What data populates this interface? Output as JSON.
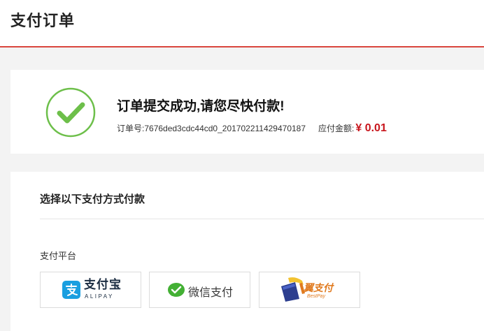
{
  "header": {
    "title": "支付订单"
  },
  "success": {
    "title": "订单提交成功,请您尽快付款!",
    "order_number_label": "订单号:",
    "order_number": "7676ded3cdc44cd0_201702211429470187",
    "amount_label": "应付金额:",
    "amount": "¥ 0.01",
    "icon": "checkmark-circle-icon",
    "colors": {
      "check": "#6dbf4a",
      "amount": "#c8161d",
      "accent_line": "#d9463e"
    }
  },
  "payment": {
    "heading": "选择以下支付方式付款",
    "platform_label": "支付平台",
    "options": [
      {
        "id": "alipay",
        "label": "支付宝",
        "sub_label": "ALIPAY",
        "icon": "alipay-logo-icon",
        "color": "#1a9fe0"
      },
      {
        "id": "wechat",
        "label": "微信支付",
        "icon": "wechat-pay-icon",
        "color": "#43b034"
      },
      {
        "id": "bestpay",
        "label": "翼支付",
        "sub_label": "BestPay",
        "icon": "bestpay-logo-icon",
        "color": "#e07a1f"
      }
    ]
  }
}
